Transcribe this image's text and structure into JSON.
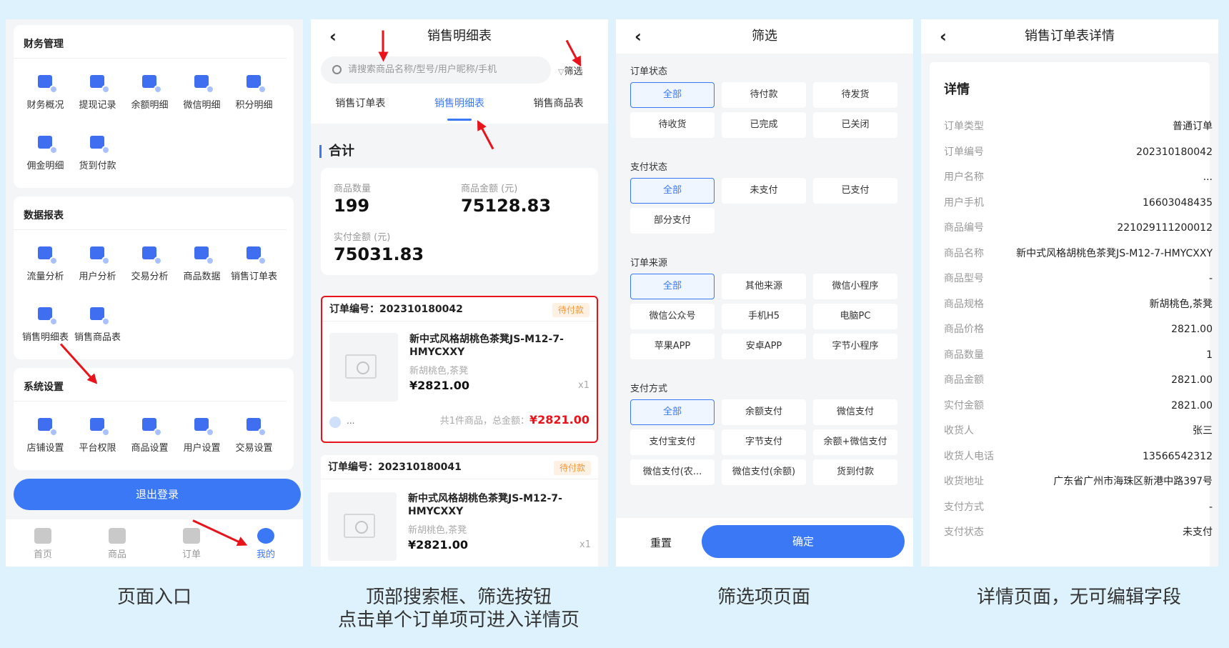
{
  "captions": {
    "c1": "页面入口",
    "c2a": "顶部搜索框、筛选按钮",
    "c2b": "点击单个订单项可进入详情页",
    "c3": "筛选项页面",
    "c4": "详情页面，无可编辑字段"
  },
  "entry": {
    "sections": [
      {
        "title": "财务管理",
        "items": [
          "财务概况",
          "提现记录",
          "余额明细",
          "微信明细",
          "积分明细",
          "佣金明细",
          "货到付款"
        ]
      },
      {
        "title": "数据报表",
        "items": [
          "流量分析",
          "用户分析",
          "交易分析",
          "商品数据",
          "销售订单表",
          "销售明细表",
          "销售商品表"
        ]
      },
      {
        "title": "系统设置",
        "items": [
          "店铺设置",
          "平台权限",
          "商品设置",
          "用户设置",
          "交易设置"
        ]
      }
    ],
    "logout": "退出登录",
    "tabbar": [
      "首页",
      "商品",
      "订单",
      "我的"
    ]
  },
  "list": {
    "title": "销售明细表",
    "search_placeholder": "请搜索商品名称/型号/用户昵称/手机",
    "filter": "筛选",
    "tabs": [
      "销售订单表",
      "销售明细表",
      "销售商品表"
    ],
    "total_title": "合计",
    "stats": {
      "qty_label": "商品数量",
      "qty": "199",
      "amount_label": "商品金额 (元)",
      "amount": "75128.83",
      "paid_label": "实付金额 (元)",
      "paid": "75031.83"
    },
    "orders": [
      {
        "no": "订单编号：202310180042",
        "status": "待付款",
        "name": "新中式风格胡桃色茶凳JS-M12-7-HMYCXXY",
        "spec": "新胡桃色,茶凳",
        "price": "¥2821.00",
        "qty": "x1",
        "user": "...",
        "summary": "共1件商品，总金额：",
        "total": "¥2821.00"
      },
      {
        "no": "订单编号：202310180041",
        "status": "待付款",
        "name": "新中式风格胡桃色茶凳JS-M12-7-HMYCXXY",
        "spec": "新胡桃色,茶凳",
        "price": "¥2821.00",
        "qty": "x1"
      }
    ]
  },
  "filter_page": {
    "title": "筛选",
    "groups": [
      {
        "title": "订单状态",
        "options": [
          "全部",
          "待付款",
          "待发货",
          "待收货",
          "已完成",
          "已关闭"
        ]
      },
      {
        "title": "支付状态",
        "options": [
          "全部",
          "未支付",
          "已支付",
          "部分支付"
        ]
      },
      {
        "title": "订单来源",
        "options": [
          "全部",
          "其他来源",
          "微信小程序",
          "微信公众号",
          "手机H5",
          "电脑PC",
          "苹果APP",
          "安卓APP",
          "字节小程序"
        ]
      },
      {
        "title": "支付方式",
        "options": [
          "全部",
          "余额支付",
          "微信支付",
          "支付宝支付",
          "字节支付",
          "余额+微信支付",
          "微信支付(农...",
          "微信支付(余额)",
          "货到付款"
        ]
      }
    ],
    "reset": "重置",
    "confirm": "确定"
  },
  "detail": {
    "title": "销售订单表详情",
    "section": "详情",
    "rows": [
      [
        "订单类型",
        "普通订单"
      ],
      [
        "订单编号",
        "202310180042"
      ],
      [
        "用户名称",
        "..."
      ],
      [
        "用户手机",
        "16603048435"
      ],
      [
        "商品编号",
        "221029111200012"
      ],
      [
        "商品名称",
        "新中式风格胡桃色茶凳JS-M12-7-HMYCXXY"
      ],
      [
        "商品型号",
        "-"
      ],
      [
        "商品规格",
        "新胡桃色,茶凳"
      ],
      [
        "商品价格",
        "2821.00"
      ],
      [
        "商品数量",
        "1"
      ],
      [
        "商品金额",
        "2821.00"
      ],
      [
        "实付金额",
        "2821.00"
      ],
      [
        "收货人",
        "张三"
      ],
      [
        "收货人电话",
        "13566542312"
      ],
      [
        "收货地址",
        "广东省广州市海珠区新港中路397号"
      ],
      [
        "支付方式",
        "-"
      ],
      [
        "支付状态",
        "未支付"
      ]
    ]
  }
}
